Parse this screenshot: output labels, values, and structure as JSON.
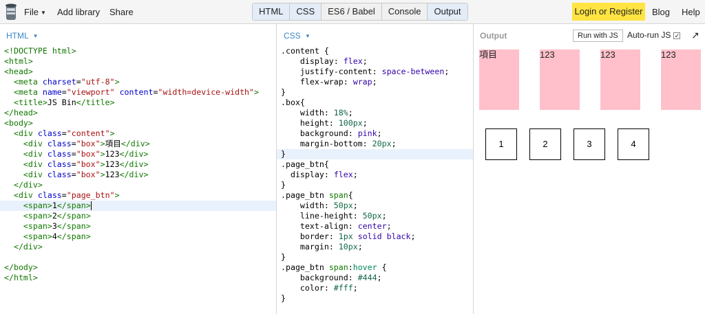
{
  "topbar": {
    "file": "File",
    "add_library": "Add library",
    "share": "Share",
    "panels": [
      "HTML",
      "CSS",
      "ES6 / Babel",
      "Console",
      "Output"
    ],
    "login": "Login or Register",
    "blog": "Blog",
    "help": "Help"
  },
  "html_panel": {
    "label": "HTML",
    "lines": [
      "<!DOCTYPE html>",
      "<html>",
      "<head>",
      "  <meta charset=\"utf-8\">",
      "  <meta name=\"viewport\" content=\"width=device-width\">",
      "  <title>JS Bin</title>",
      "</head>",
      "<body>",
      "  <div class=\"content\">",
      "    <div class=\"box\">項目</div>",
      "    <div class=\"box\">123</div>",
      "    <div class=\"box\">123</div>",
      "    <div class=\"box\">123</div>",
      "  </div>",
      "  <div class=\"page_btn\">",
      "    <span>1</span>",
      "    <span>2</span>",
      "    <span>3</span>",
      "    <span>4</span>",
      "  </div>",
      "",
      "</body>",
      "</html>"
    ]
  },
  "css_panel": {
    "label": "CSS",
    "lines": [
      ".content {",
      "    display: flex;",
      "    justify-content: space-between;",
      "    flex-wrap: wrap;",
      "}",
      ".box{",
      "    width: 18%;",
      "    height: 100px;",
      "    background: pink;",
      "    margin-bottom: 20px;",
      "}",
      ".page_btn{",
      "  display: flex;",
      "}",
      ".page_btn span{",
      "    width: 50px;",
      "    line-height: 50px;",
      "    text-align: center;",
      "    border: 1px solid black;",
      "    margin: 10px;",
      "}",
      ".page_btn span:hover {",
      "    background: #444;",
      "    color: #fff;",
      "}"
    ]
  },
  "output_panel": {
    "label": "Output",
    "run_button": "Run with JS",
    "autorun": "Auto-run JS",
    "autorun_checked": "✓",
    "popout": "↗",
    "boxes": [
      "項目",
      "123",
      "123",
      "123"
    ],
    "pages": [
      "1",
      "2",
      "3",
      "4"
    ]
  }
}
